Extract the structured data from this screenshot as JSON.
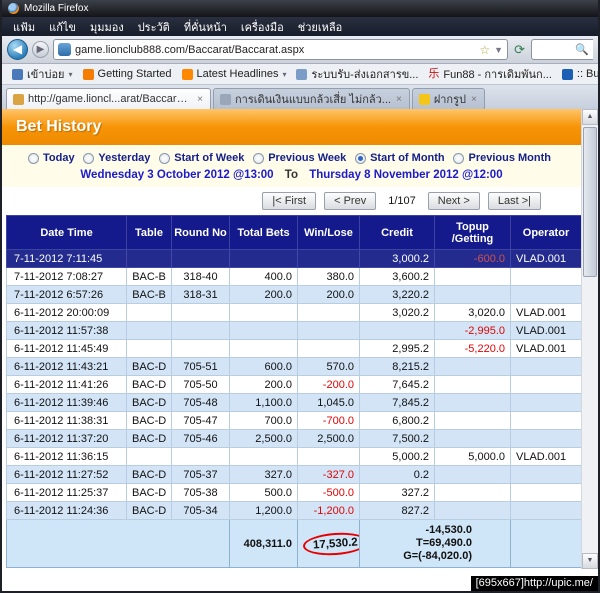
{
  "browser": {
    "title": "Mozilla Firefox",
    "menu_items": [
      "แฟ้ม",
      "แก้ไข",
      "มุมมอง",
      "ประวัติ",
      "ที่คั่นหน้า",
      "เครื่องมือ",
      "ช่วยเหลือ"
    ],
    "url": "game.lionclub888.com/Baccarat/Baccarat.aspx",
    "bookmarks": [
      {
        "label": "เข้าบ่อย",
        "icon": "most-visited-icon",
        "icon_color": "#4a78b8",
        "dropdown": true
      },
      {
        "label": "Getting Started",
        "icon": "firefox-icon",
        "icon_color": "#f57c00",
        "dropdown": false
      },
      {
        "label": "Latest Headlines",
        "icon": "rss-icon",
        "icon_color": "#ff8800",
        "dropdown": true
      },
      {
        "label": "ระบบรับ-ส่งเอกสารข...",
        "icon": "document-icon",
        "icon_color": "#7a9cc6",
        "dropdown": false
      },
      {
        "label": "Fun88 - การเดิมพันก...",
        "icon": "fun88-icon",
        "icon_color": "#cc1111",
        "icon_char": "乐",
        "dropdown": false
      },
      {
        "label": ":: Bualuang",
        "icon": "bualuang-icon",
        "icon_color": "#1a5fb4",
        "dropdown": false
      }
    ],
    "tabs": [
      {
        "label": "http://game.lioncl...arat/Baccarat.aspx",
        "active": true,
        "icon_color": "#d9a441"
      },
      {
        "label": "การเดินเงินแบบกล้วเสี่ย ไม่กล้ว...",
        "active": false,
        "icon_color": "#9aa7b8"
      },
      {
        "label": "ฝากรูป",
        "active": false,
        "icon_color": "#f5c518"
      }
    ]
  },
  "page": {
    "title": "Bet History",
    "filters": [
      {
        "label": "Today",
        "selected": false
      },
      {
        "label": "Yesterday",
        "selected": false
      },
      {
        "label": "Start of Week",
        "selected": false
      },
      {
        "label": "Previous Week",
        "selected": false
      },
      {
        "label": "Start of Month",
        "selected": true
      },
      {
        "label": "Previous Month",
        "selected": false
      }
    ],
    "date_from": "Wednesday 3 October 2012 @13:00",
    "date_to_label": "To",
    "date_to": "Thursday 8 November 2012 @12:00",
    "pagination": {
      "first": "|< First",
      "prev": "< Prev",
      "page": "1/107",
      "next": "Next >",
      "last": "Last >|"
    }
  },
  "table": {
    "headers": [
      "Date Time",
      "Table",
      "Round No",
      "Total Bets",
      "Win/Lose",
      "Credit",
      "Topup\n/Getting",
      "Operator"
    ],
    "rows": [
      {
        "dt": "7-11-2012 7:11:45",
        "table": "",
        "round": "",
        "bets": "",
        "win": "",
        "credit": "3,000.2",
        "topup": "-600.0",
        "op": "VLAD.001",
        "highlight": true
      },
      {
        "dt": "7-11-2012 7:08:27",
        "table": "BAC-B",
        "round": "318-40",
        "bets": "400.0",
        "win": "380.0",
        "credit": "3,600.2",
        "topup": "",
        "op": ""
      },
      {
        "dt": "7-11-2012 6:57:26",
        "table": "BAC-B",
        "round": "318-31",
        "bets": "200.0",
        "win": "200.0",
        "credit": "3,220.2",
        "topup": "",
        "op": ""
      },
      {
        "dt": "6-11-2012 20:00:09",
        "table": "",
        "round": "",
        "bets": "",
        "win": "",
        "credit": "3,020.2",
        "topup": "3,020.0",
        "op": "VLAD.001"
      },
      {
        "dt": "6-11-2012 11:57:38",
        "table": "",
        "round": "",
        "bets": "",
        "win": "",
        "credit": "",
        "topup": "-2,995.0",
        "op": "VLAD.001"
      },
      {
        "dt": "6-11-2012 11:45:49",
        "table": "",
        "round": "",
        "bets": "",
        "win": "",
        "credit": "2,995.2",
        "topup": "-5,220.0",
        "op": "VLAD.001"
      },
      {
        "dt": "6-11-2012 11:43:21",
        "table": "BAC-D",
        "round": "705-51",
        "bets": "600.0",
        "win": "570.0",
        "credit": "8,215.2",
        "topup": "",
        "op": ""
      },
      {
        "dt": "6-11-2012 11:41:26",
        "table": "BAC-D",
        "round": "705-50",
        "bets": "200.0",
        "win": "-200.0",
        "credit": "7,645.2",
        "topup": "",
        "op": ""
      },
      {
        "dt": "6-11-2012 11:39:46",
        "table": "BAC-D",
        "round": "705-48",
        "bets": "1,100.0",
        "win": "1,045.0",
        "credit": "7,845.2",
        "topup": "",
        "op": ""
      },
      {
        "dt": "6-11-2012 11:38:31",
        "table": "BAC-D",
        "round": "705-47",
        "bets": "700.0",
        "win": "-700.0",
        "credit": "6,800.2",
        "topup": "",
        "op": ""
      },
      {
        "dt": "6-11-2012 11:37:20",
        "table": "BAC-D",
        "round": "705-46",
        "bets": "2,500.0",
        "win": "2,500.0",
        "credit": "7,500.2",
        "topup": "",
        "op": ""
      },
      {
        "dt": "6-11-2012 11:36:15",
        "table": "",
        "round": "",
        "bets": "",
        "win": "",
        "credit": "5,000.2",
        "topup": "5,000.0",
        "op": "VLAD.001"
      },
      {
        "dt": "6-11-2012 11:27:52",
        "table": "BAC-D",
        "round": "705-37",
        "bets": "327.0",
        "win": "-327.0",
        "credit": "0.2",
        "topup": "",
        "op": ""
      },
      {
        "dt": "6-11-2012 11:25:37",
        "table": "BAC-D",
        "round": "705-38",
        "bets": "500.0",
        "win": "-500.0",
        "credit": "327.2",
        "topup": "",
        "op": ""
      },
      {
        "dt": "6-11-2012 11:24:36",
        "table": "BAC-D",
        "round": "705-34",
        "bets": "1,200.0",
        "win": "-1,200.0",
        "credit": "827.2",
        "topup": "",
        "op": ""
      }
    ]
  },
  "totals": {
    "total_bets": "408,311.0",
    "win_lose": "17,530.2",
    "summary": [
      "-14,530.0",
      "T=69,490.0",
      "G=(-84,020.0)"
    ]
  },
  "colors": {
    "banner_orange": "#F79406",
    "header_navy": "#141A8C",
    "highlight_row_navy": "#232C8E",
    "row_blue": "#D2E4F6",
    "negative_red": "#E00505",
    "footer_blue": "#CFE5F8"
  },
  "watermark": "[695x667]http://upic.me/"
}
